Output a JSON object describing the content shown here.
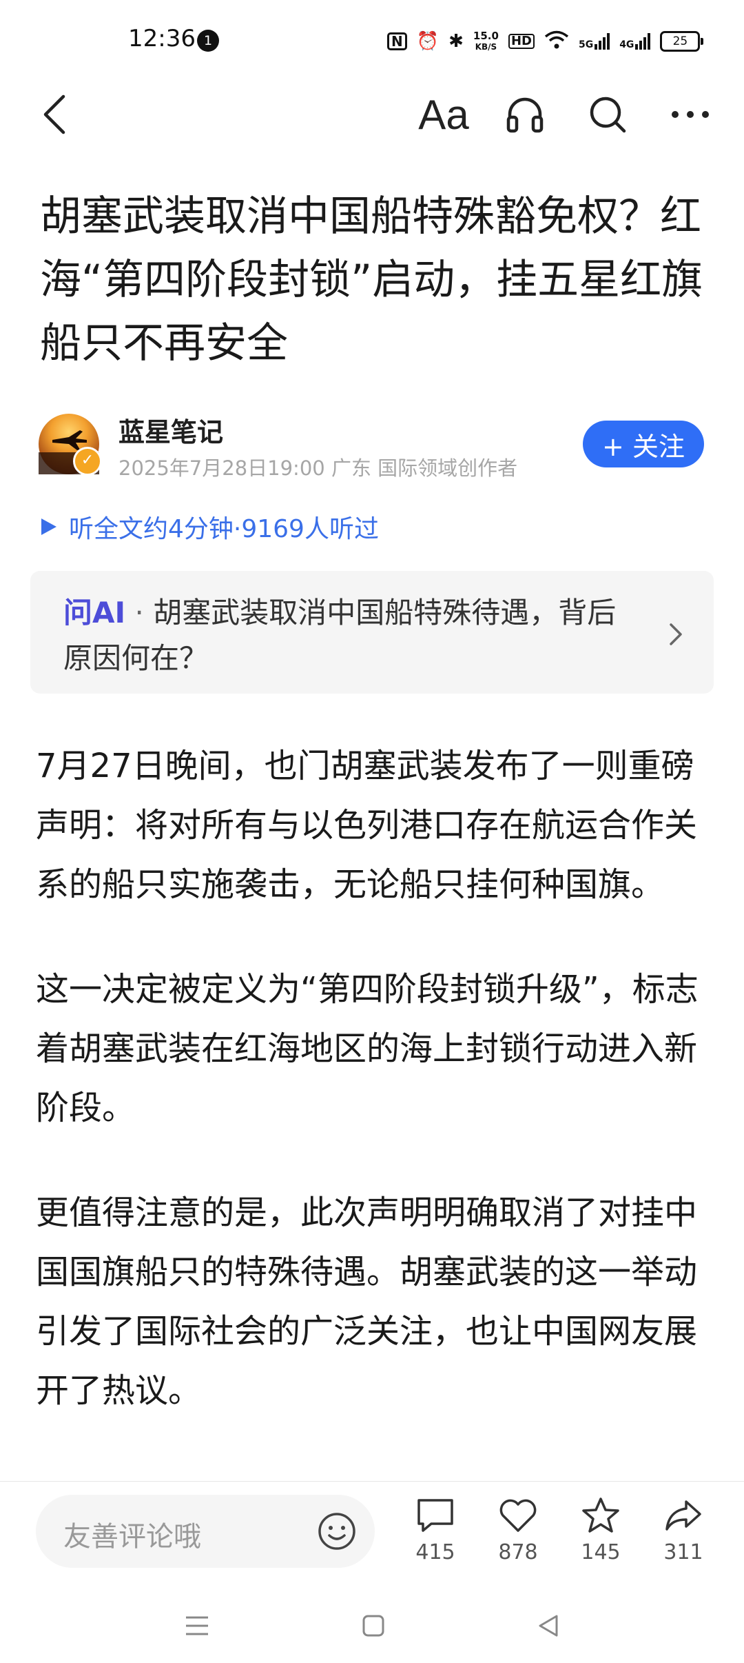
{
  "status_bar": {
    "time": "12:36",
    "notification_count": "1",
    "nfc": "N",
    "net_speed_value": "15.0",
    "net_speed_unit": "KB/S",
    "hd_label": "HD",
    "signal_5g": "5G",
    "signal_4g": "4G",
    "battery": "25"
  },
  "nav": {
    "font_size_label": "Aa"
  },
  "article": {
    "title": "胡塞武装取消中国船特殊豁免权？红海“第四阶段封锁”启动，挂五星红旗船只不再安全",
    "author": {
      "name": "蓝星笔记",
      "meta": "2025年7月28日19:00 广东 国际领域创作者"
    },
    "follow_label": "+ 关注",
    "listen_text": "听全文约4分钟·9169人听过",
    "ask_ai": {
      "brand": "问AI",
      "separator": "·",
      "question": "胡塞武装取消中国船特殊待遇，背后原因何在？"
    },
    "paragraphs": [
      "7月27日晚间，也门胡塞武装发布了一则重磅声明：将对所有与以色列港口存在航运合作关系的船只实施袭击，无论船只挂何种国旗。",
      "这一决定被定义为“第四阶段封锁升级”，标志着胡塞武装在红海地区的海上封锁行动进入新阶段。",
      "更值得注意的是，此次声明明确取消了对挂中国国旗船只的特殊待遇。胡塞武装的这一举动引发了国际社会的广泛关注，也让中国网友展开了热议。"
    ]
  },
  "bottom_bar": {
    "comment_placeholder": "友善评论哦",
    "comments_count": "415",
    "likes_count": "878",
    "favorites_count": "145",
    "shares_count": "311"
  },
  "colors": {
    "accent_blue": "#2f6ef6",
    "link_blue": "#3a6fe8",
    "ai_purple": "#4d4dd8"
  }
}
